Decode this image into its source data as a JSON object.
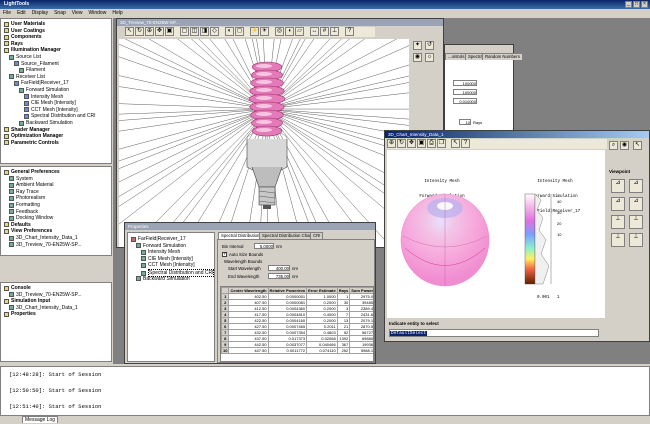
{
  "app": {
    "title": "LightTools"
  },
  "menu": [
    "File",
    "Edit",
    "Display",
    "Snap",
    "View",
    "Window",
    "Help"
  ],
  "system_tree": {
    "items": [
      {
        "label": "User Materials",
        "indent": 0
      },
      {
        "label": "User Coatings",
        "indent": 0
      },
      {
        "label": "Components",
        "indent": 0
      },
      {
        "label": "Rays",
        "indent": 0
      },
      {
        "label": "Illumination Manager",
        "indent": 0
      },
      {
        "label": "Source List",
        "indent": 1
      },
      {
        "label": "Source_Filament",
        "indent": 2
      },
      {
        "label": "Filament",
        "indent": 3
      },
      {
        "label": "Receiver List",
        "indent": 1
      },
      {
        "label": "FarField|Receiver_17",
        "indent": 2
      },
      {
        "label": "Forward Simulation",
        "indent": 3
      },
      {
        "label": "Intensity Mesh",
        "indent": 4
      },
      {
        "label": "CIE Mesh [Intensity]",
        "indent": 4
      },
      {
        "label": "CCT Mesh [Intensity]",
        "indent": 4
      },
      {
        "label": "Spectral Distribution and CRI",
        "indent": 4
      },
      {
        "label": "Backward Simulation",
        "indent": 3
      },
      {
        "label": "Shader Manager",
        "indent": 0
      },
      {
        "label": "Optimization Manager",
        "indent": 0
      },
      {
        "label": "Parametric Controls",
        "indent": 0
      }
    ]
  },
  "prefs_tree": {
    "items": [
      {
        "label": "General Preferences",
        "indent": 0
      },
      {
        "label": "System",
        "indent": 1
      },
      {
        "label": "Ambient Material",
        "indent": 1
      },
      {
        "label": "Ray Trace",
        "indent": 1
      },
      {
        "label": "Photorealism",
        "indent": 1
      },
      {
        "label": "Formatting",
        "indent": 1
      },
      {
        "label": "Feedback",
        "indent": 1
      },
      {
        "label": "Docking Window",
        "indent": 1
      },
      {
        "label": "Defaults",
        "indent": 0
      },
      {
        "label": "View Preferences",
        "indent": 0
      },
      {
        "label": "3D_Chart_Intensity_Data_1",
        "indent": 1
      },
      {
        "label": "3D_Treview_70-EN25W-SP...",
        "indent": 1
      }
    ]
  },
  "window_tree": {
    "items": [
      {
        "label": "Console",
        "indent": 0
      },
      {
        "label": "3D_Treview_70-EN25W-SP...",
        "indent": 1
      },
      {
        "label": "Simulation Input",
        "indent": 0
      },
      {
        "label": "3D_Chart_Intensity_Data_1",
        "indent": 1
      },
      {
        "label": "Properties",
        "indent": 0
      }
    ]
  },
  "view3d": {
    "title": "3D_Treview_70-EN25W-SP..."
  },
  "partial_window": {
    "tabs": [
      "...ontrols",
      "Spectral",
      "Random Numbers"
    ],
    "values": [
      "100000",
      "100000",
      "0.010000"
    ],
    "rays_value": "10",
    "rays_unit": "Rays"
  },
  "properties": {
    "title": "Properties",
    "tree": [
      "FarField|Receiver_17",
      "Forward Simulation",
      "Intensity Mesh",
      "CIE Mesh [Intensity]",
      "CCT Mesh [Intensity]",
      "Spectral Distribution and CRI",
      "Backward Simulation"
    ],
    "tabs": [
      "Spectral Distribution",
      "Spectral Distribution Chart",
      "CRI"
    ],
    "bin_interval_label": "Bin Interval",
    "bin_interval_value": "5.0000",
    "bin_interval_unit": "nm",
    "auto_size_label": "Auto Size Bounds",
    "wavelength_bounds_label": "Wavelength Bounds",
    "start_label": "Start Wavelength",
    "start_value": "400.00",
    "end_label": "End Wavelength",
    "end_value": "735.00",
    "unit": "nm",
    "columns": [
      "",
      "Center Wavelength",
      "Relative Power/nm",
      "Error Estimate",
      "Rays",
      "Sum Power",
      "Varian"
    ],
    "rows": [
      [
        "1",
        "402.50",
        "0.0000051",
        "1.0000",
        "1",
        "2975.0",
        "8.6052e+"
      ],
      [
        "2",
        "407.50",
        "0.0000081",
        "0.2000",
        "30",
        "39485",
        "4.0988e+"
      ],
      [
        "3",
        "412.50",
        "0.0004360",
        "0.2000",
        "3",
        "2389.4",
        "1.7611e+"
      ],
      [
        "4",
        "417.50",
        "0.0004810",
        "0.4000",
        "7",
        "2431.6",
        "9.3020e+"
      ],
      [
        "5",
        "422.50",
        "0.0004160",
        "0.2000",
        "13",
        "2079.1",
        "4.7239e+"
      ],
      [
        "6",
        "427.50",
        "0.0007465",
        "0.2011",
        "21",
        "2870.5",
        "5.2020e+"
      ],
      [
        "7",
        "432.50",
        "0.0007354",
        "0.4803",
        "52",
        "56727",
        "2.0904e+"
      ],
      [
        "8",
        "437.50",
        "0.017373",
        "0.02068",
        "1392",
        "69880",
        "5.4098e+"
      ],
      [
        "9",
        "442.50",
        "0.0037077",
        "0.040466",
        "367",
        "19936",
        "6.3465e+"
      ],
      [
        "10",
        "447.50",
        "0.0011772",
        "0.074110",
        "252",
        "5988.1",
        "1.8030e+"
      ]
    ]
  },
  "chart_window": {
    "title": "3D_Chart_Intensity_Data_1",
    "left_label": [
      "Intensity Mesh",
      "Forward Simulation",
      "FarField|Receiver_17"
    ],
    "right_label": [
      "Intensity Mesh",
      "Forward Simulation",
      "FarField|Receiver_17"
    ],
    "scale_ticks": [
      "40",
      "30",
      "20",
      "10"
    ],
    "scale_min": "0.001",
    "scale_max": "1",
    "prompt": "Indicate entity to select",
    "command_value": "DefaultSelect"
  },
  "viewpoint": {
    "label": "Viewpoint"
  },
  "log": {
    "lines": [
      "[12:48:28]: Start of Session",
      "[12:50:50]: Start of Session",
      "[12:51:40]: Start of Session"
    ],
    "tab": "Message Log"
  }
}
